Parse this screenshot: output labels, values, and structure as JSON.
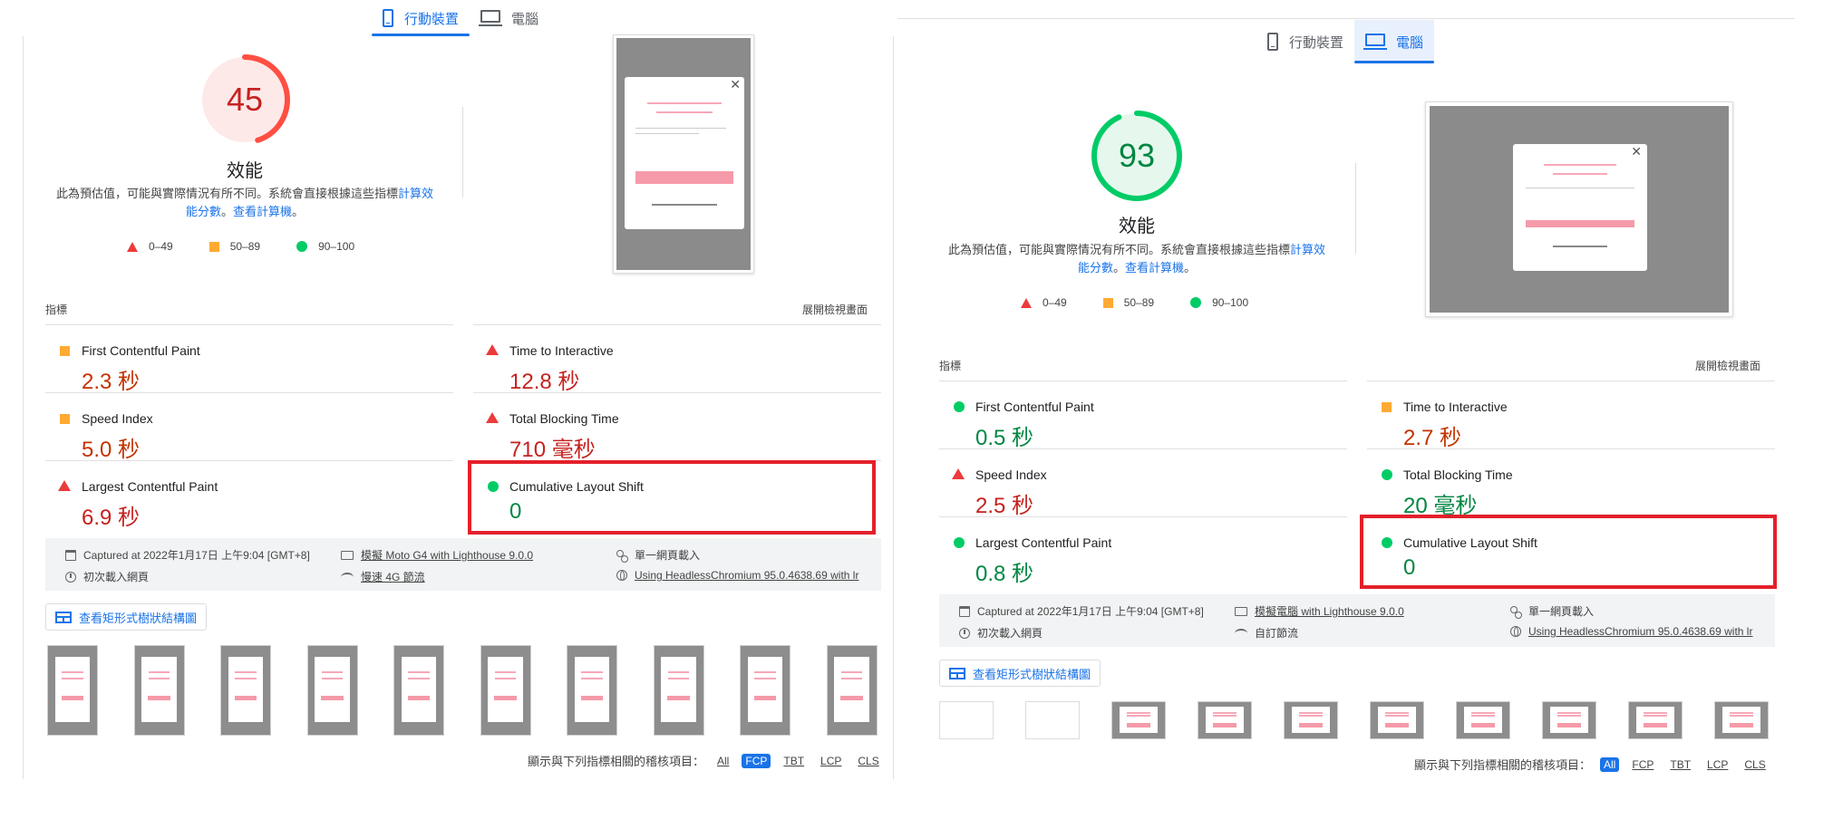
{
  "tabs": {
    "mobile_label": "行動裝置",
    "desktop_label": "電腦"
  },
  "colors": {
    "fail": "#ff4e42",
    "average": "#ffaa33",
    "pass": "#00cc66",
    "accent": "#1a73e8",
    "highlight": "#e3202a"
  },
  "gauge": {
    "title": "效能",
    "desc_text": "此為預估值，可能與實際情況有所不同。系統會直接根據這些指標",
    "desc_link1": "計算效能分數",
    "desc_sep": "。",
    "desc_link2": "查看計算機",
    "desc_end": "。"
  },
  "legend": {
    "fail": "0–49",
    "average": "50–89",
    "pass": "90–100"
  },
  "metrics_label": "指標",
  "expand_label": "展開檢視畫面",
  "treemap_label": "查看矩形式樹狀結構圖",
  "filter_label": "顯示與下列指標相關的稽核項目：",
  "filters": [
    "All",
    "FCP",
    "TBT",
    "LCP",
    "CLS"
  ],
  "mobile": {
    "score": 45,
    "score_fraction": 0.45,
    "metrics": [
      {
        "name": "First Contentful Paint",
        "value": "2.3 秒",
        "rating": "average"
      },
      {
        "name": "Time to Interactive",
        "value": "12.8 秒",
        "rating": "fail"
      },
      {
        "name": "Speed Index",
        "value": "5.0 秒",
        "rating": "average"
      },
      {
        "name": "Total Blocking Time",
        "value": "710 毫秒",
        "rating": "fail"
      },
      {
        "name": "Largest Contentful Paint",
        "value": "6.9 秒",
        "rating": "fail"
      },
      {
        "name": "Cumulative Layout Shift",
        "value": "0",
        "rating": "pass"
      }
    ],
    "info": {
      "captured": "Captured at 2022年1月17日 上午9:04 [GMT+8]",
      "initial_load": "初次載入網頁",
      "device_prefix": "模擬 Moto G4 with Lighthouse 9.0.0",
      "throttle": "慢速 4G 節流",
      "single_load": "單一網頁載入",
      "browser": "Using HeadlessChromium 95.0.4638.69 with lr"
    },
    "active_filter": "FCP"
  },
  "desktop": {
    "score": 93,
    "score_fraction": 0.93,
    "metrics": [
      {
        "name": "First Contentful Paint",
        "value": "0.5 秒",
        "rating": "pass"
      },
      {
        "name": "Time to Interactive",
        "value": "2.7 秒",
        "rating": "average"
      },
      {
        "name": "Speed Index",
        "value": "2.5 秒",
        "rating": "fail"
      },
      {
        "name": "Total Blocking Time",
        "value": "20 毫秒",
        "rating": "pass"
      },
      {
        "name": "Largest Contentful Paint",
        "value": "0.8 秒",
        "rating": "pass"
      },
      {
        "name": "Cumulative Layout Shift",
        "value": "0",
        "rating": "pass"
      }
    ],
    "info": {
      "captured": "Captured at 2022年1月17日 上午9:04 [GMT+8]",
      "initial_load": "初次載入網頁",
      "device_prefix": "模擬電腦 with Lighthouse 9.0.0",
      "throttle": "自訂節流",
      "single_load": "單一網頁載入",
      "browser": "Using HeadlessChromium 95.0.4638.69 with lr"
    },
    "active_filter": "All"
  }
}
